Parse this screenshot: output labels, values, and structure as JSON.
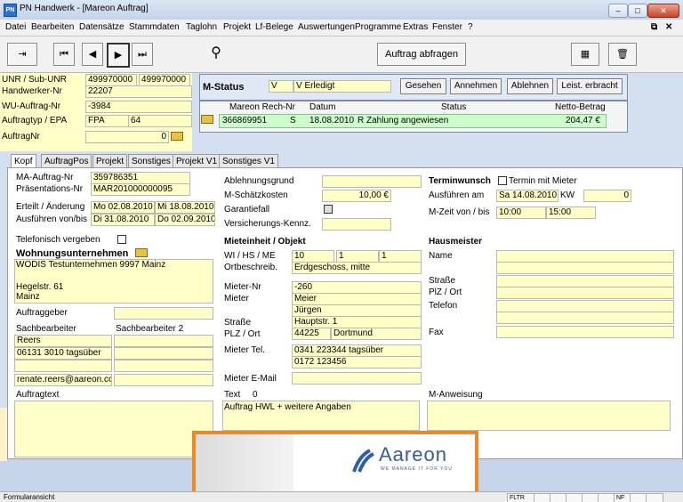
{
  "window": {
    "title": "PN Handwerk - [Mareon Auftrag]",
    "app_icon": "PN"
  },
  "menu": [
    "Datei",
    "Bearbeiten",
    "Datensätze",
    "Stammdaten",
    "Taglohn",
    "Projekt",
    "Lf-Belege",
    "Auswertungen",
    "Programme",
    "Extras",
    "Fenster",
    "?"
  ],
  "toolbar": {
    "auftrag_abfragen": "Auftrag abfragen"
  },
  "header": {
    "unr_label": "UNR / Sub-UNR",
    "unr": "499970000",
    "sub_unr": "499970000",
    "hw_nr_label": "Handwerker-Nr",
    "hw_nr": "22207",
    "wu_label": "WU-Auftrag-Nr",
    "wu": "-3984",
    "auftragtyp_label": "Auftragtyp / EPA",
    "auftragtyp": "FPA",
    "epa": "64",
    "auftragnr_label": "AuftragNr",
    "auftragnr": "0"
  },
  "mstatus": {
    "label": "M-Status",
    "code": "V",
    "text": "V Erledigt",
    "buttons": [
      "Gesehen",
      "Annehmen",
      "Ablehnen",
      "Leist. erbracht"
    ]
  },
  "rech": {
    "headers": [
      "Mareon Rech-Nr",
      "Datum",
      "Status",
      "Netto-Betrag"
    ],
    "row": {
      "nr": "366869951",
      "s": "S",
      "datum": "18.08.2010",
      "status": "R Zahlung angewiesen",
      "betrag": "204,47 €"
    }
  },
  "tabs": [
    "Kopf",
    "AuftragPos",
    "Projekt",
    "Sonstiges",
    "Projekt V1",
    "Sonstiges V1"
  ],
  "kopf": {
    "ma_auftrag_label": "MA-Auftrag-Nr",
    "ma_auftrag": "359786351",
    "praes_label": "Präsentations-Nr",
    "praes": "MAR201000000095",
    "erteilt_label": "Erteilt / Änderung",
    "erteilt": "Mo 02.08.2010",
    "aenderung": "Mi 18.08.2010",
    "ausf_label": "Ausführen von/bis",
    "ausf_von": "Di 31.08.2010",
    "ausf_bis": "Do 02.09.2010",
    "telefon_label": "Telefonisch vergeben",
    "wu_label": "Wohnungsunternehmen",
    "wu_lines": [
      "WODIS Testunternehmen 9997 Mainz",
      "",
      "",
      "Hegelstr. 61",
      "Mainz"
    ],
    "auftraggeber_label": "Auftraggeber",
    "sb_label": "Sachbearbeiter",
    "sb2_label": "Sachbearbeiter 2",
    "sb_lines": [
      "Reers",
      "06131 3010 tagsüber",
      "",
      "renate.reers@aareon.com"
    ],
    "auftragtext_label": "Auftragtext",
    "ablehnung_label": "Ablehnungsgrund",
    "schaetz_label": "M-Schätzkosten",
    "schaetz": "10,00 €",
    "garantie_label": "Garantiefall",
    "versich_label": "Versicherungs-Kennz.",
    "mieteinheit_label": "Mieteinheit / Objekt",
    "wi_label": "WI / HS / ME",
    "wi": "10",
    "hs": "1",
    "me": "1",
    "ort_label": "Ortbeschreib.",
    "ort": "Erdgeschoss, mitte",
    "mieternr_label": "Mieter-Nr",
    "mieternr": "-260",
    "mieter_label": "Mieter",
    "mieter1": "Meier",
    "mieter2": "Jürgen",
    "strasse_label": "Straße",
    "strasse": "Hauptstr. 1",
    "plz_label": "PLZ / Ort",
    "plz": "44225",
    "stadt": "Dortmund",
    "tel_label": "Mieter Tel.",
    "tel1": "0341 223344 tagsüber",
    "tel2": "0172 123456",
    "email_label": "Mieter E-Mail",
    "text_label": "Text",
    "text_count": "0",
    "text_value": "Auftrag HWL + weitere Angaben",
    "termin_label": "Terminwunsch",
    "termin_mieter_label": "Termin mit Mieter",
    "ausf_am_label": "Ausführen am",
    "ausf_am": "Sa 14.08.2010",
    "kw_label": "KW",
    "kw": "0",
    "mzeit_label": "M-Zeit von / bis",
    "mzeit_von": "10:00",
    "mzeit_bis": "15:00",
    "hausmeister_label": "Hausmeister",
    "hm_name_label": "Name",
    "hm_strasse_label": "Straße",
    "hm_plz_label": "PlZ / Ort",
    "hm_tel_label": "Telefon",
    "hm_fax_label": "Fax",
    "manweisung_label": "M-Anweisung"
  },
  "overlay": {
    "logo_text": "Aareon",
    "tagline": "WE MANAGE IT FOR YOU",
    "accent": "#e8892b"
  },
  "status": {
    "left": "Formularansicht",
    "fltr": "FLTR",
    "nf": "NF"
  },
  "colors": {
    "field_yellow": "#ffffc8",
    "row_green": "#ccffcc",
    "window_blue": "#d4dff0"
  }
}
